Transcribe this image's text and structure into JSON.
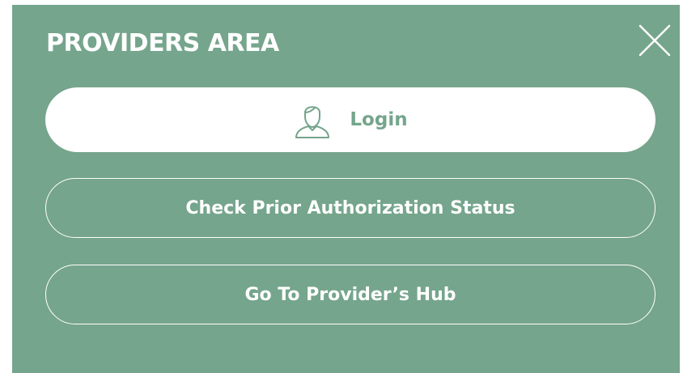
{
  "panel": {
    "title": "PROVIDERS AREA",
    "close_icon": "close-icon"
  },
  "buttons": {
    "login": {
      "label": "Login",
      "icon": "user-icon"
    },
    "check_auth": {
      "label": "Check Prior Authorization Status"
    },
    "provider_hub": {
      "label": "Go To Provider’s Hub"
    }
  },
  "colors": {
    "panel_background": "#75a58c",
    "text_on_panel": "#ffffff",
    "login_text": "#75a58c"
  }
}
